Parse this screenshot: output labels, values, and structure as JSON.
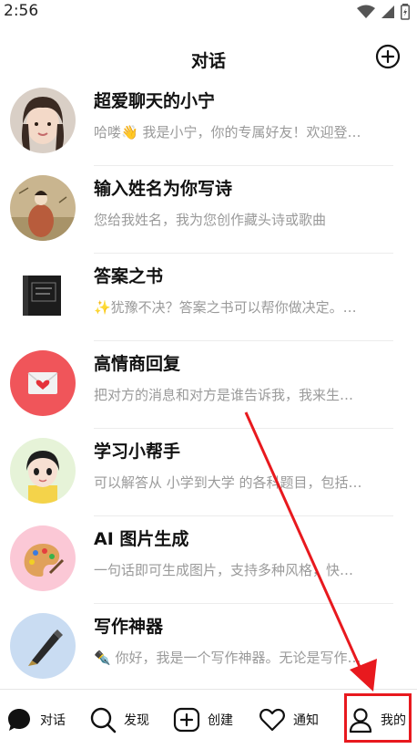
{
  "status": {
    "time": "2:56"
  },
  "header": {
    "title": "对话",
    "add_icon": "plus-circle-icon"
  },
  "chats": [
    {
      "name": "超爱聊天的小宁",
      "snippet": "哈喽👋 我是小宁，你的专属好友！欢迎登…",
      "avatar": "girl-portrait"
    },
    {
      "name": "输入姓名为你写诗",
      "snippet": "您给我姓名，我为您创作藏头诗或歌曲",
      "avatar": "classical-painting"
    },
    {
      "name": "答案之书",
      "snippet": "✨犹豫不决？答案之书可以帮你做决定。…",
      "avatar": "black-book"
    },
    {
      "name": "高情商回复",
      "snippet": "把对方的消息和对方是谁告诉我，我来生…",
      "avatar": "envelope"
    },
    {
      "name": "学习小帮手",
      "snippet": "可以解答从 小学到大学 的各科题目，包括…",
      "avatar": "cartoon-girl"
    },
    {
      "name": "AI 图片生成",
      "snippet": "一句话即可生成图片，支持多种风格，快…",
      "avatar": "palette"
    },
    {
      "name": "写作神器",
      "snippet": "✒️ 你好，我是一个写作神器。无论是写作…",
      "avatar": "fountain-pen"
    }
  ],
  "nav": [
    {
      "label": "对话",
      "icon": "chat-bubble-icon"
    },
    {
      "label": "发现",
      "icon": "search-icon"
    },
    {
      "label": "创建",
      "icon": "plus-square-icon"
    },
    {
      "label": "通知",
      "icon": "heart-icon"
    },
    {
      "label": "我的",
      "icon": "person-icon"
    }
  ],
  "colors": {
    "highlight": "#e8191e",
    "divider": "#ececec",
    "snippet": "#9a9a9a"
  }
}
